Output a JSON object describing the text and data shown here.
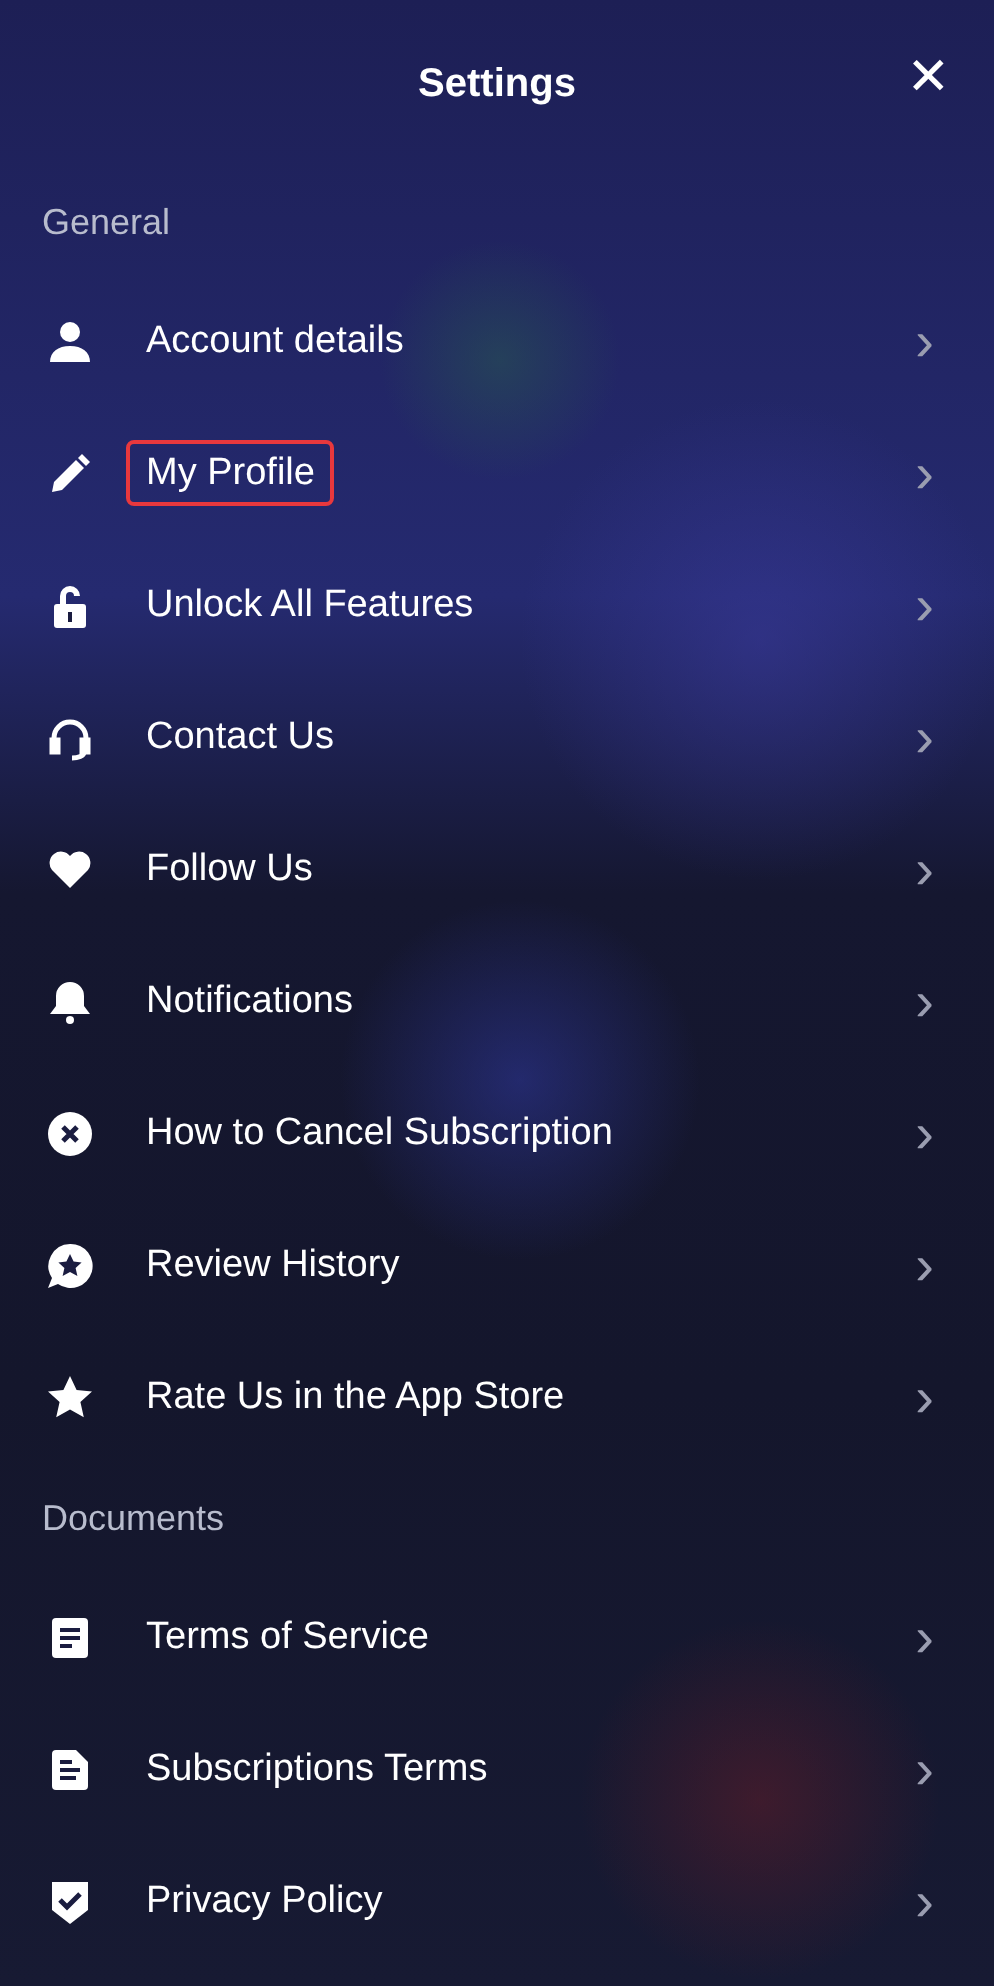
{
  "header": {
    "title": "Settings",
    "close": "✕"
  },
  "sections": [
    {
      "label": "General",
      "items": [
        {
          "label": "Account details",
          "kind": "person",
          "highlighted": false,
          "chevron": "›"
        },
        {
          "label": "My Profile",
          "kind": "pencil",
          "highlighted": true,
          "chevron": "›"
        },
        {
          "label": "Unlock All Features",
          "kind": "lock",
          "highlighted": false,
          "chevron": "›"
        },
        {
          "label": "Contact Us",
          "kind": "headset",
          "highlighted": false,
          "chevron": "›"
        },
        {
          "label": "Follow Us",
          "kind": "heart",
          "highlighted": false,
          "chevron": "›"
        },
        {
          "label": "Notifications",
          "kind": "bell",
          "highlighted": false,
          "chevron": "›"
        },
        {
          "label": "How to Cancel Subscription",
          "kind": "xcircle",
          "highlighted": false,
          "chevron": "›"
        },
        {
          "label": "Review History",
          "kind": "bubblestar",
          "highlighted": false,
          "chevron": "›"
        },
        {
          "label": "Rate Us in the App Store",
          "kind": "star",
          "highlighted": false,
          "chevron": "›"
        }
      ]
    },
    {
      "label": "Documents",
      "items": [
        {
          "label": "Terms of Service",
          "kind": "doc",
          "highlighted": false,
          "chevron": "›"
        },
        {
          "label": "Subscriptions Terms",
          "kind": "docfold",
          "highlighted": false,
          "chevron": "›"
        },
        {
          "label": "Privacy Policy",
          "kind": "shield",
          "highlighted": false,
          "chevron": "›"
        }
      ]
    }
  ]
}
